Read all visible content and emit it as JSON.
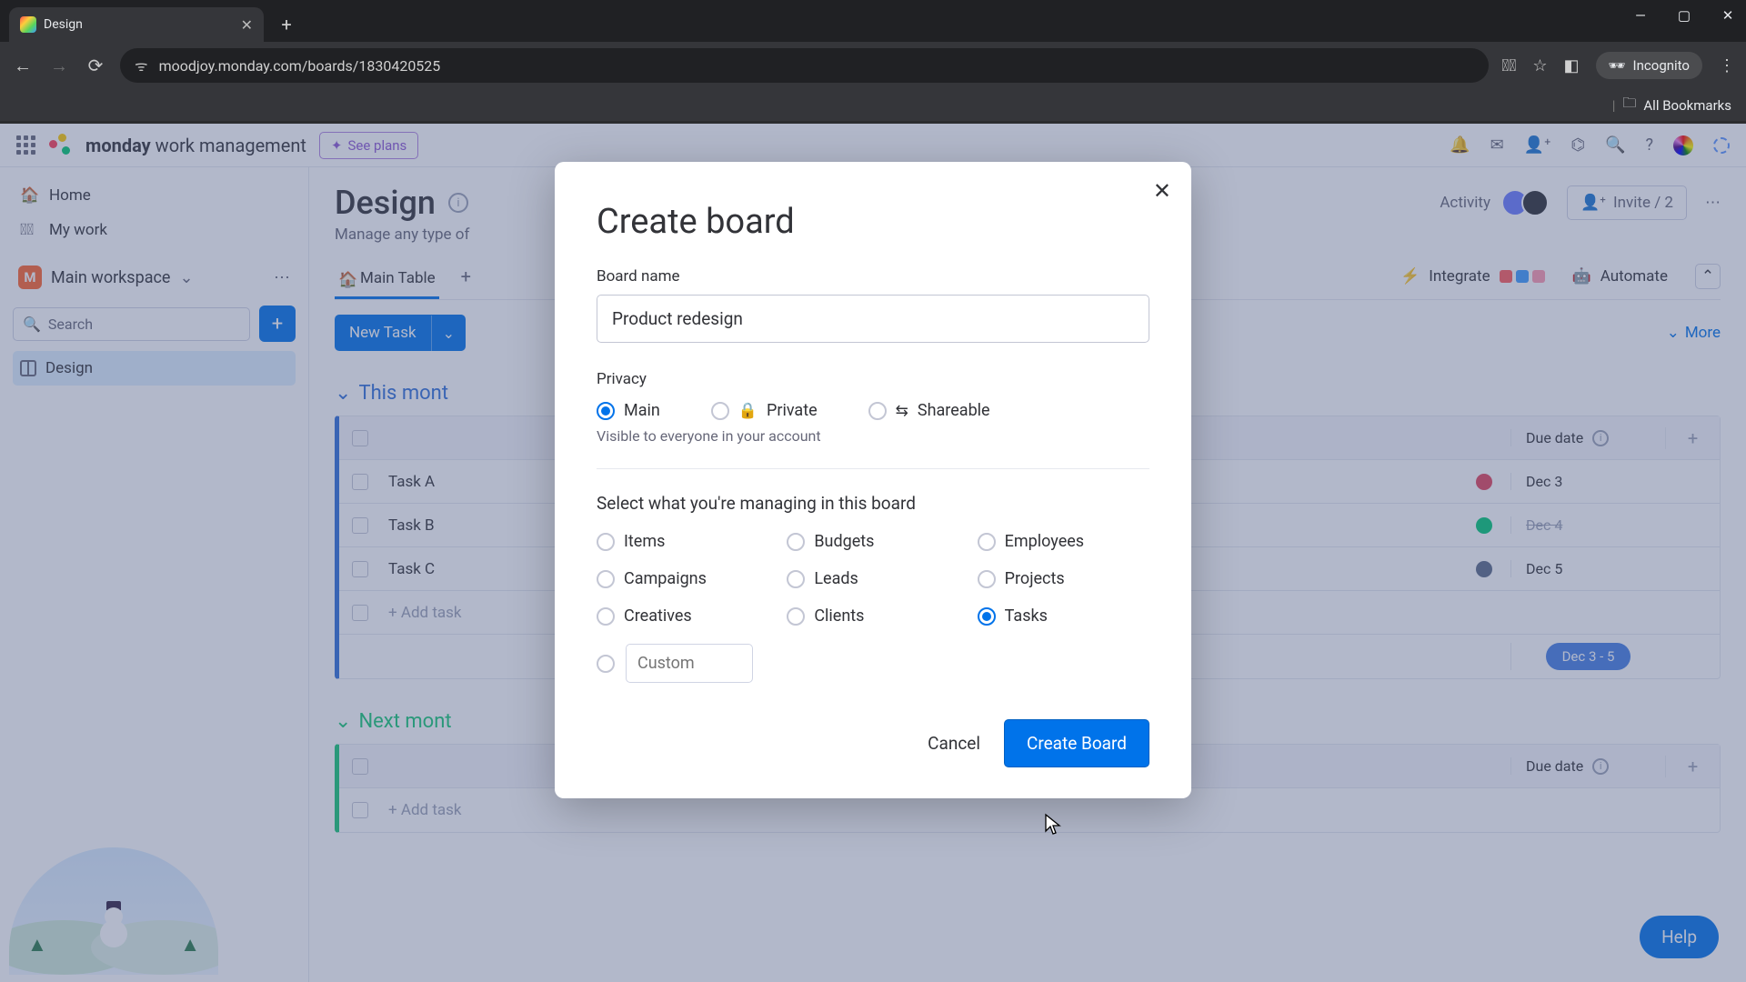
{
  "browser": {
    "tab_title": "Design",
    "url": "moodjoy.monday.com/boards/1830420525",
    "incognito_label": "Incognito",
    "all_bookmarks": "All Bookmarks"
  },
  "header": {
    "brand_bold": "monday",
    "brand_rest": " work management",
    "see_plans": "See plans"
  },
  "sidebar": {
    "home": "Home",
    "my_work": "My work",
    "workspace_initial": "M",
    "workspace_name": "Main workspace",
    "search_placeholder": "Search",
    "board_item": "Design"
  },
  "page": {
    "title": "Design",
    "subtitle": "Manage any type of",
    "activity": "Activity",
    "invite": "Invite / 2",
    "tab_main": "Main Table",
    "integrate": "Integrate",
    "automate": "Automate",
    "new_task": "New Task",
    "more": "More"
  },
  "groups": {
    "g1": {
      "title": "This mont",
      "rows": [
        "Task A",
        "Task B",
        "Task C"
      ],
      "add": "+ Add task",
      "due_header": "Due date",
      "dues": [
        "Dec 3",
        "Dec 4",
        "Dec 5"
      ],
      "timeline": "Dec 3 - 5"
    },
    "g2": {
      "title": "Next mont",
      "add": "+ Add task",
      "due_header": "Due date"
    }
  },
  "help": "Help",
  "modal": {
    "title": "Create board",
    "name_label": "Board name",
    "name_value": "Product redesign",
    "privacy_label": "Privacy",
    "privacy_main": "Main",
    "privacy_private": "Private",
    "privacy_shareable": "Shareable",
    "privacy_hint": "Visible to everyone in your account",
    "managing_title": "Select what you're managing in this board",
    "opts": {
      "items": "Items",
      "budgets": "Budgets",
      "employees": "Employees",
      "campaigns": "Campaigns",
      "leads": "Leads",
      "projects": "Projects",
      "creatives": "Creatives",
      "clients": "Clients",
      "tasks": "Tasks"
    },
    "custom_placeholder": "Custom",
    "cancel": "Cancel",
    "create": "Create Board"
  }
}
